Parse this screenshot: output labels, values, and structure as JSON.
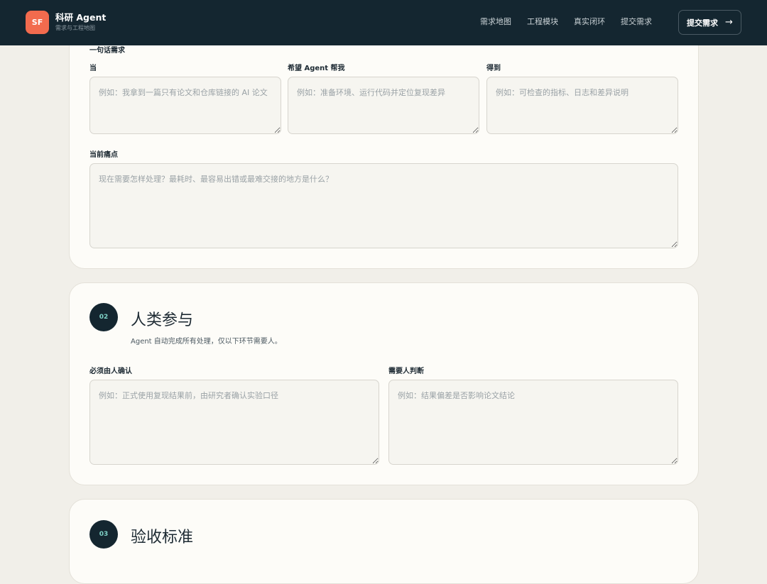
{
  "brand": {
    "logo_text": "SF",
    "title": "科研 Agent",
    "subtitle": "需求与工程地图"
  },
  "nav": {
    "items": [
      "需求地图",
      "工程模块",
      "真实闭环",
      "提交需求"
    ],
    "submit_label": "提交需求",
    "submit_arrow": "→"
  },
  "section1": {
    "partial_label": "一句话需求",
    "when_label": "当",
    "when_placeholder": "例如：我拿到一篇只有论文和仓库链接的 AI 论文",
    "want_label": "希望 Agent 帮我",
    "want_placeholder": "例如：准备环境、运行代码并定位复现差异",
    "get_label": "得到",
    "get_placeholder": "例如：可检查的指标、日志和差异说明",
    "pain_label": "当前痛点",
    "pain_placeholder": "现在需要怎样处理？最耗时、最容易出错或最难交接的地方是什么？"
  },
  "section2": {
    "number": "02",
    "title": "人类参与",
    "description": "Agent 自动完成所有处理，仅以下环节需要人。",
    "confirm_label": "必须由人确认",
    "confirm_placeholder": "例如：正式使用复现结果前，由研究者确认实验口径",
    "judge_label": "需要人判断",
    "judge_placeholder": "例如：结果偏差是否影响论文结论"
  },
  "section3": {
    "number": "03",
    "title": "验收标准"
  }
}
